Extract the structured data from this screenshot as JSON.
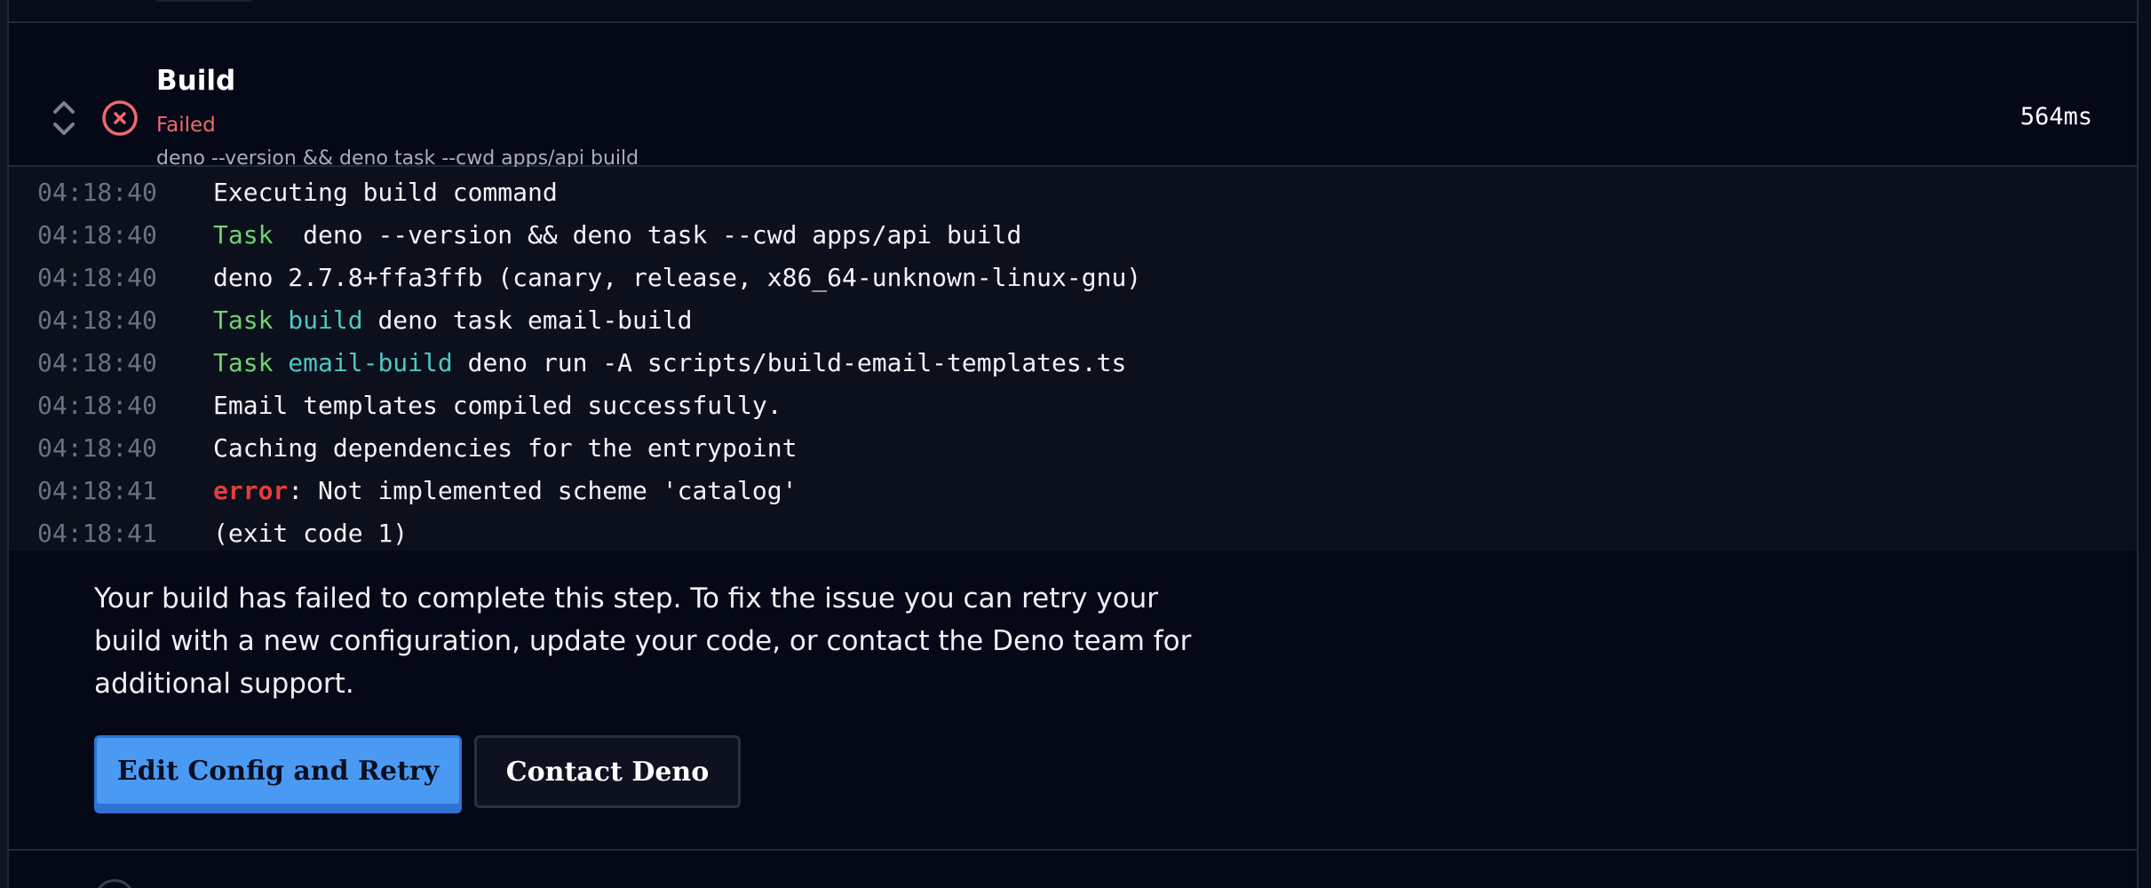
{
  "step": {
    "title": "Build",
    "status": "Failed",
    "command": "deno --version && deno task --cwd apps/api build",
    "duration": "564ms",
    "status_color": "#f0686b"
  },
  "log": [
    {
      "time": "04:18:40",
      "segments": [
        {
          "text": "Executing build command",
          "kind": "plain"
        }
      ]
    },
    {
      "time": "04:18:40",
      "segments": [
        {
          "text": "Task",
          "kind": "task"
        },
        {
          "text": "  deno --version && deno task --cwd apps/api build",
          "kind": "plain"
        }
      ]
    },
    {
      "time": "04:18:40",
      "segments": [
        {
          "text": "deno 2.7.8+ffa3ffb (canary, release, x86_64-unknown-linux-gnu)",
          "kind": "plain"
        }
      ]
    },
    {
      "time": "04:18:40",
      "segments": [
        {
          "text": "Task",
          "kind": "task"
        },
        {
          "text": " ",
          "kind": "plain"
        },
        {
          "text": "build",
          "kind": "name"
        },
        {
          "text": " deno task email-build",
          "kind": "plain"
        }
      ]
    },
    {
      "time": "04:18:40",
      "segments": [
        {
          "text": "Task",
          "kind": "task"
        },
        {
          "text": " ",
          "kind": "plain"
        },
        {
          "text": "email-build",
          "kind": "name"
        },
        {
          "text": " deno run -A scripts/build-email-templates.ts",
          "kind": "plain"
        }
      ]
    },
    {
      "time": "04:18:40",
      "segments": [
        {
          "text": "Email templates compiled successfully.",
          "kind": "plain"
        }
      ]
    },
    {
      "time": "04:18:40",
      "segments": [
        {
          "text": "Caching dependencies for the entrypoint",
          "kind": "plain"
        }
      ]
    },
    {
      "time": "04:18:41",
      "segments": [
        {
          "text": "error",
          "kind": "error"
        },
        {
          "text": ": Not implemented scheme 'catalog'",
          "kind": "plain"
        }
      ]
    },
    {
      "time": "04:18:41",
      "segments": [
        {
          "text": "(exit code 1)",
          "kind": "plain"
        }
      ]
    }
  ],
  "failure": {
    "message": "Your build has failed to complete this step. To fix the issue you can retry your build with a new configuration, update your code, or contact the Deno team for additional support.",
    "primary_button": "Edit Config and Retry",
    "secondary_button": "Contact Deno"
  },
  "icons": {
    "expand": "chevron-up-down-icon",
    "status": "x-circle-icon"
  },
  "colors": {
    "background": "#050816",
    "log_background": "#0c101c",
    "task": "#6fd36f",
    "name": "#4fc7c2",
    "error": "#e43d3d",
    "primary": "#4a9af4"
  }
}
